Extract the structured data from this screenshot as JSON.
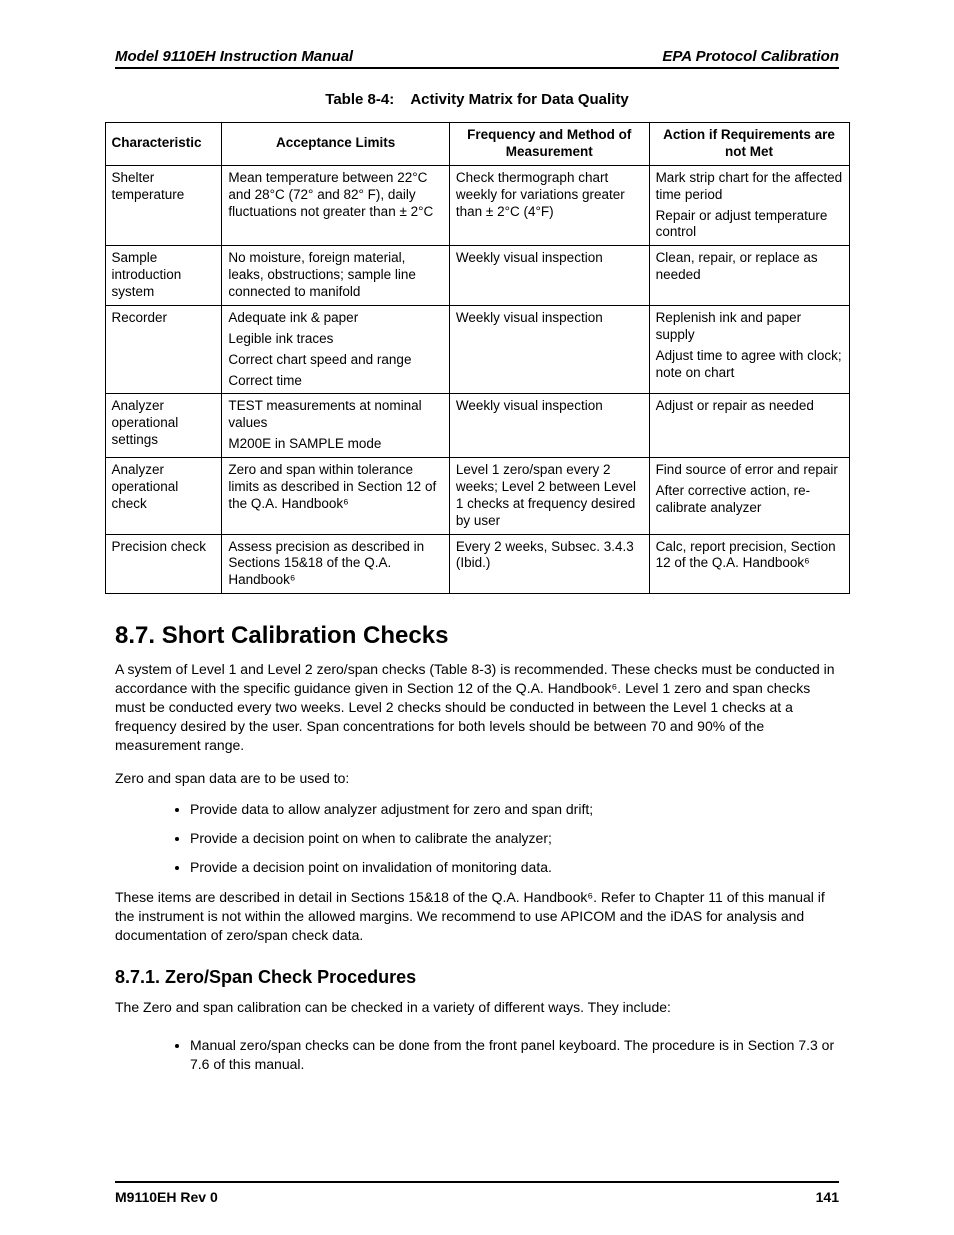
{
  "header": {
    "left": "Model 9110EH Instruction Manual",
    "right": "EPA Protocol Calibration"
  },
  "table": {
    "caption_label": "Table 8-4:",
    "caption_title": "Activity Matrix for Data Quality",
    "head": {
      "characteristic": "Characteristic",
      "acceptance": "Acceptance Limits",
      "frequency": "Frequency and Method of Measurement",
      "action": "Action if Requirements are not Met"
    },
    "rows": [
      {
        "characteristic": "Shelter temperature",
        "acceptance": [
          "Mean temperature between 22°C and 28°C (72° and 82° F), daily fluctuations not greater than ± 2°C"
        ],
        "frequency": [
          "Check thermograph chart weekly for variations greater than ± 2°C (4°F)"
        ],
        "action": [
          "Mark strip chart for the affected time period",
          "Repair or adjust temperature control"
        ]
      },
      {
        "characteristic": "Sample introduction system",
        "acceptance": [
          "No moisture, foreign material, leaks, obstructions; sample line connected to manifold"
        ],
        "frequency": [
          "Weekly visual inspection"
        ],
        "action": [
          "Clean, repair, or replace as needed"
        ]
      },
      {
        "characteristic": "Recorder",
        "acceptance": [
          "Adequate ink & paper",
          "Legible ink traces",
          "Correct chart speed and range",
          "Correct time"
        ],
        "frequency": [
          "Weekly visual inspection"
        ],
        "action": [
          "Replenish ink and paper supply",
          "Adjust time to agree with clock; note on chart"
        ]
      },
      {
        "characteristic": "Analyzer operational settings",
        "acceptance": [
          "TEST measurements at nominal values",
          "M200E in SAMPLE mode"
        ],
        "frequency": [
          "Weekly visual inspection"
        ],
        "action": [
          "Adjust or repair as needed"
        ]
      },
      {
        "characteristic": "Analyzer operational check",
        "acceptance": [
          "Zero and span within tolerance limits as described in Section 12 of the Q.A. Handbook⁶"
        ],
        "frequency": [
          "Level 1 zero/span every 2 weeks; Level 2 between Level 1 checks at frequency desired by user"
        ],
        "action": [
          "Find source of error and repair",
          "After corrective action, re-calibrate analyzer"
        ]
      },
      {
        "characteristic": "Precision check",
        "acceptance": [
          "Assess precision as described in Sections 15&18 of the Q.A. Handbook⁶"
        ],
        "frequency": [
          "Every 2 weeks, Subsec. 3.4.3 (Ibid.)"
        ],
        "action": [
          "Calc, report precision, Section 12 of the Q.A. Handbook⁶"
        ]
      }
    ]
  },
  "section": {
    "heading": "8.7. Short Calibration Checks",
    "para1": "A system of Level 1 and Level 2 zero/span checks (Table 8-3) is recommended. These checks must be conducted in accordance with the specific guidance given in Section 12 of the Q.A. Handbook⁶. Level 1 zero and span checks must be conducted every two weeks. Level 2 checks should be conducted in between the Level 1 checks at a frequency desired by the user. Span concentrations for both levels should be between 70 and 90% of the measurement range.",
    "lead2": "Zero and span data are to be used to:",
    "bullets1": [
      "Provide data to allow analyzer adjustment for zero and span drift;",
      "Provide a decision point on when to calibrate the analyzer;",
      "Provide a decision point on invalidation of monitoring data."
    ],
    "para3": "These items are described in detail in Sections 15&18 of the Q.A. Handbook⁶. Refer to Chapter 11 of this manual if the instrument is not within the allowed margins. We recommend to use APICOM and the iDAS for analysis and documentation of zero/span check data.",
    "subheading": "8.7.1. Zero/Span Check Procedures",
    "para4": "The Zero and span calibration can be checked in a variety of different ways. They include:",
    "bullets2": [
      "Manual zero/span checks can be done from the front panel keyboard. The procedure is in Section 7.3 or 7.6 of this manual."
    ]
  },
  "footer": {
    "left": "M9110EH Rev 0",
    "right": "141"
  }
}
